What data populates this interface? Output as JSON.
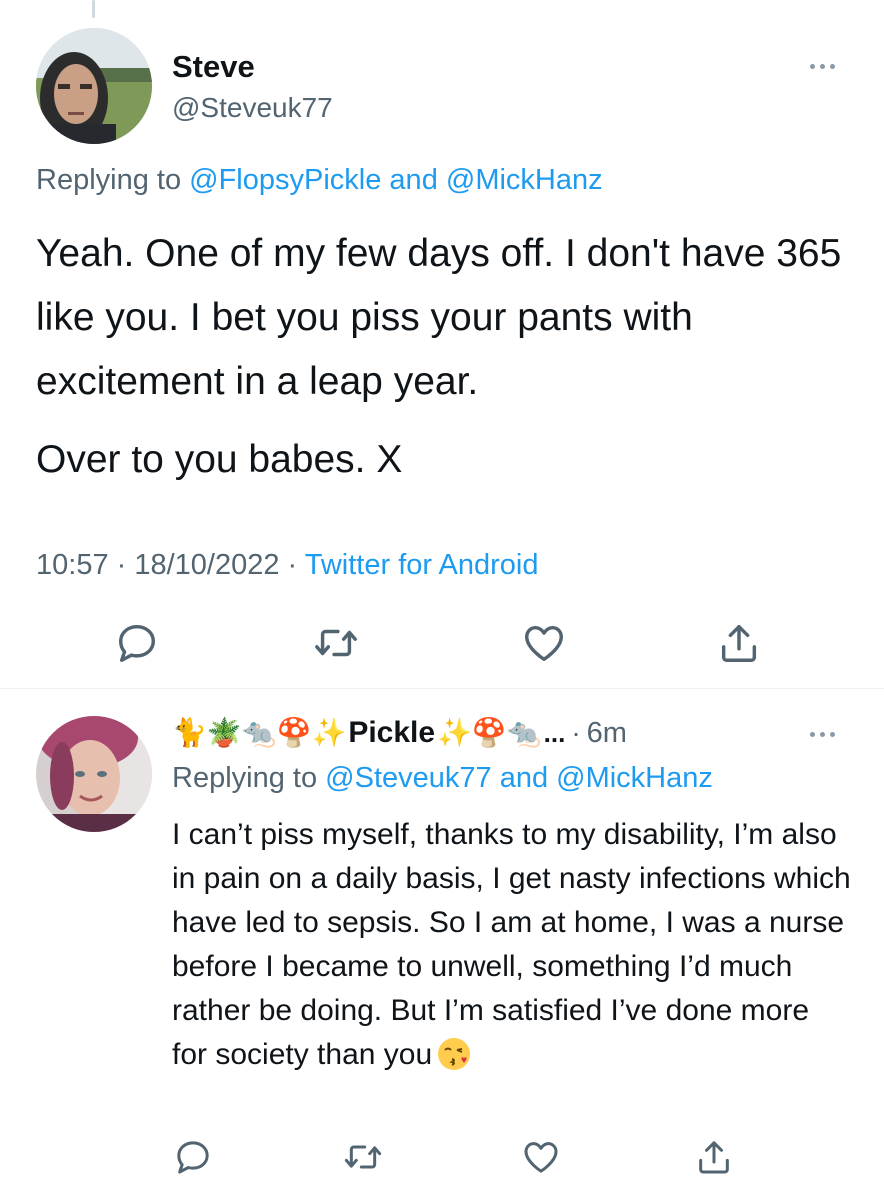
{
  "tweet1": {
    "name": "Steve",
    "handle": "@Steveuk77",
    "reply_prefix": "Replying to ",
    "reply_user1": "@FlopsyPickle",
    "reply_and": " and ",
    "reply_user2": "@MickHanz",
    "text_p1": "Yeah. One of my few days off. I don't have 365 like you. I bet you piss your pants with excitement in a  leap year.",
    "text_p2": "Over to you babes. X",
    "time": "10:57 · 18/10/2022 · ",
    "source": "Twitter for Android"
  },
  "tweet2": {
    "emoji_prefix": "🐈🪴🐀🍄✨",
    "name": "Pickle",
    "emoji_suffix": "✨🍄🐀",
    "ellipsis": "...",
    "dot": "·",
    "time": "6m",
    "reply_prefix": "Replying to ",
    "reply_user1": "@Steveuk77",
    "reply_and": " and ",
    "reply_user2": "@MickHanz",
    "text": "I can’t piss myself, thanks to my disability, I’m also in pain on a daily basis, I get nasty infections which have led to sepsis. So I am at home, I was a nurse before I became to unwell, something I’d much rather be doing. But I’m satisfied I’ve done more for society than you"
  },
  "icons": [
    "reply-icon",
    "retweet-icon",
    "like-icon",
    "share-icon",
    "more-icon",
    "kissing-face-emoji"
  ],
  "colors": {
    "link": "#1d9bf0",
    "secondary": "#536471",
    "text": "#0f1419",
    "icon": "#536471"
  }
}
